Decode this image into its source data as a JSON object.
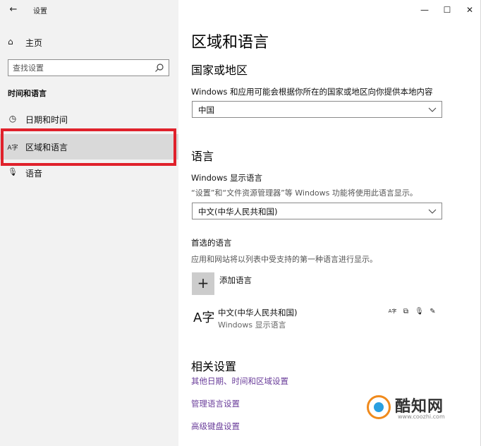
{
  "window": {
    "title": "设置",
    "back_icon": "←",
    "minimize_icon": "—",
    "maximize_icon": "☐",
    "close_icon": "✕"
  },
  "sidebar": {
    "home": {
      "icon": "⌂",
      "label": "主页"
    },
    "search": {
      "placeholder": "查找设置"
    },
    "section_heading": "时间和语言",
    "items": [
      {
        "icon": "◷",
        "label": "日期和时间",
        "selected": false
      },
      {
        "icon": "A字",
        "label": "区域和语言",
        "selected": true
      },
      {
        "icon": "🎙",
        "label": "语音",
        "selected": false
      }
    ],
    "highlight_color": "#e0212b"
  },
  "main": {
    "page_title": "区域和语言",
    "country": {
      "heading": "国家或地区",
      "description": "Windows 和应用可能会根据你所在的国家或地区向你提供本地内容",
      "selected": "中国"
    },
    "language": {
      "heading": "语言",
      "display_label": "Windows 显示语言",
      "display_description": "“设置”和“文件资源管理器”等 Windows 功能将使用此语言显示。",
      "display_selected": "中文(中华人民共和国)",
      "preferred_label": "首选的语言",
      "preferred_description": "应用和网站将以列表中受支持的第一种语言进行显示。",
      "add_label": "添加语言",
      "add_icon": "+",
      "installed": [
        {
          "icon": "A字",
          "name": "中文(中华人民共和国)",
          "sub": "Windows 显示语言",
          "features": [
            "A字",
            "⧉",
            "🎙",
            "✎"
          ]
        }
      ]
    },
    "related": {
      "heading": "相关设置",
      "links": [
        "其他日期、时间和区域设置",
        "管理语言设置",
        "高级键盘设置"
      ]
    }
  },
  "watermark": {
    "name": "酷知网",
    "url": "www.coozhi.com"
  },
  "colors": {
    "sidebar_bg": "#f2f2f2",
    "selected_bg": "#d9d9d9",
    "link": "#6a3d9a"
  }
}
